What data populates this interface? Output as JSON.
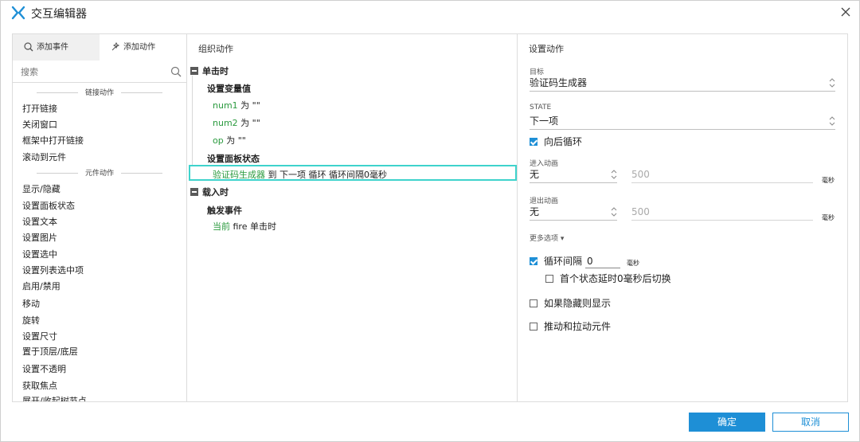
{
  "window": {
    "title": "交互编辑器"
  },
  "left": {
    "tab_add_event": "添加事件",
    "tab_add_action": "添加动作",
    "search_placeholder": "搜索",
    "section_link": "链接动作",
    "link_items": [
      "打开链接",
      "关闭窗口",
      "框架中打开链接",
      "滚动到元件"
    ],
    "section_widget": "元件动作",
    "widget_items": [
      "显示/隐藏",
      "设置面板状态",
      "设置文本",
      "设置图片",
      "设置选中",
      "设置列表选中项",
      "启用/禁用",
      "移动",
      "旋转",
      "设置尺寸",
      "置于顶层/底层",
      "设置不透明",
      "获取焦点",
      "展开/收起树节点"
    ]
  },
  "middle": {
    "heading": "组织动作",
    "event1": "单击时",
    "action_set_var": "设置变量值",
    "var1_name": "num1",
    "var1_rest": " 为 \"\"",
    "var2_name": "num2",
    "var2_rest": " 为 \"\"",
    "var3_name": "op",
    "var3_rest": " 为 \"\"",
    "action_set_panel": "设置面板状态",
    "panel_target": "验证码生成器",
    "panel_rest": " 到 下一项 循环 循环间隔0毫秒",
    "event2": "载入时",
    "action_fire": "触发事件",
    "fire_target": "当前",
    "fire_rest": " fire 单击时"
  },
  "right": {
    "heading": "设置动作",
    "target_label": "目标",
    "target_value": "验证码生成器",
    "state_label": "STATE",
    "state_value": "下一项",
    "wrap_label": "向后循环",
    "enter_anim_label": "进入动画",
    "enter_anim_value": "无",
    "enter_anim_duration": "500",
    "unit_ms": "毫秒",
    "exit_anim_label": "退出动画",
    "exit_anim_value": "无",
    "exit_anim_duration": "500",
    "more_options": "更多选项 ▾",
    "loop_interval_label": "循环间隔",
    "loop_interval_value": "0",
    "first_state_delay": "首个状态延时0毫秒后切换",
    "show_if_hidden": "如果隐藏则显示",
    "push_pull": "推动和拉动元件"
  },
  "footer": {
    "ok": "确定",
    "cancel": "取消"
  },
  "colors": {
    "accent": "#1e8fd6",
    "green_text": "#2a9a3e",
    "selection_border": "#3fd3cc"
  }
}
